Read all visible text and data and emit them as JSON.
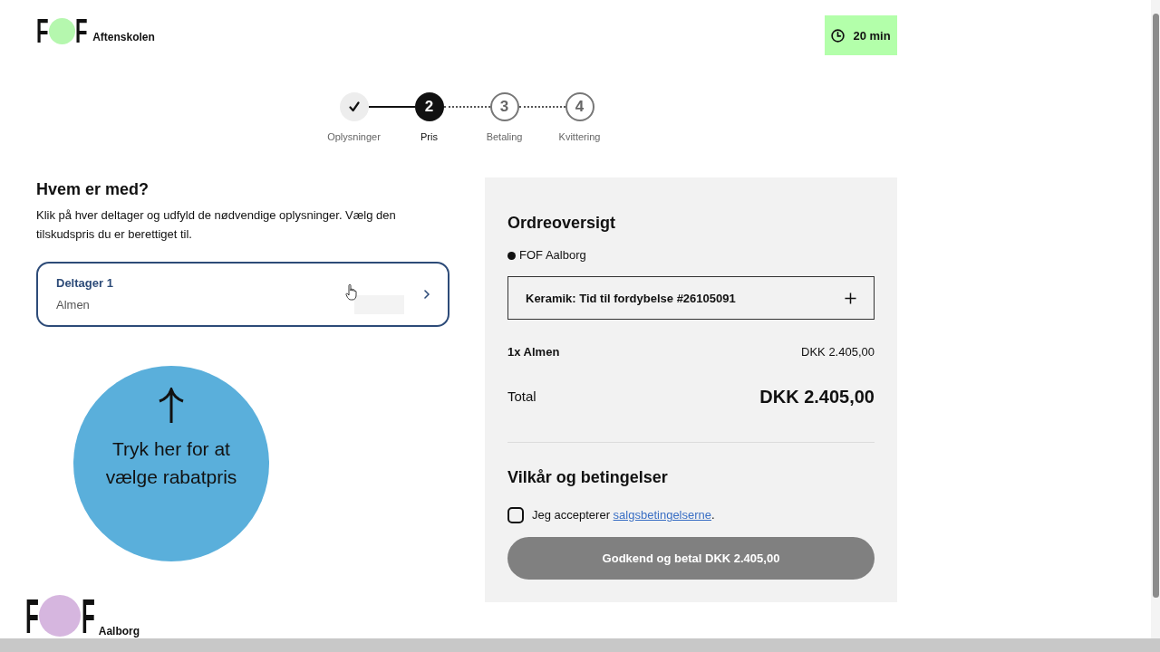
{
  "header": {
    "logo": {
      "letters": [
        "F",
        "F"
      ],
      "name": "Aftenskolen"
    },
    "timer": {
      "label": "20 min"
    }
  },
  "steps": [
    {
      "label": "Oplysninger",
      "completed": true,
      "selected": false
    },
    {
      "number": "2",
      "label": "Pris",
      "completed": false,
      "selected": true
    },
    {
      "number": "3",
      "label": "Betaling",
      "completed": false,
      "selected": false
    },
    {
      "number": "4",
      "label": "Kvittering",
      "completed": false,
      "selected": false
    }
  ],
  "participants": {
    "heading": "Hvem er med?",
    "intro": "Klik på hver deltager og udfyld de nødvendige oplysninger. Vælg den tilskudspris du er berettiget til.",
    "items": [
      {
        "title": "Deltager 1",
        "price_type": "Almen"
      }
    ]
  },
  "callout": {
    "text": "Tryk her for at vælge rabatpris"
  },
  "order_summary": {
    "heading": "Ordreoversigt",
    "provider": "FOF Aalborg",
    "course": {
      "title": "Keramik: Tid til fordybelse #26105091",
      "expanded": false
    },
    "lines": [
      {
        "label": "1x Almen",
        "amount": "DKK 2.405,00"
      }
    ],
    "total": {
      "label": "Total",
      "amount": "DKK 2.405,00"
    }
  },
  "terms": {
    "heading": "Vilkår og betingelser",
    "checked": false,
    "text": "Jeg accepterer",
    "link": "salgsbetingelserne",
    "after_link": "."
  },
  "pay_button": {
    "label": "Godkend og betal DKK 2.405,00",
    "disabled": true
  },
  "footer_logo": {
    "letters": [
      "F",
      "F"
    ],
    "name": "Aalborg"
  }
}
